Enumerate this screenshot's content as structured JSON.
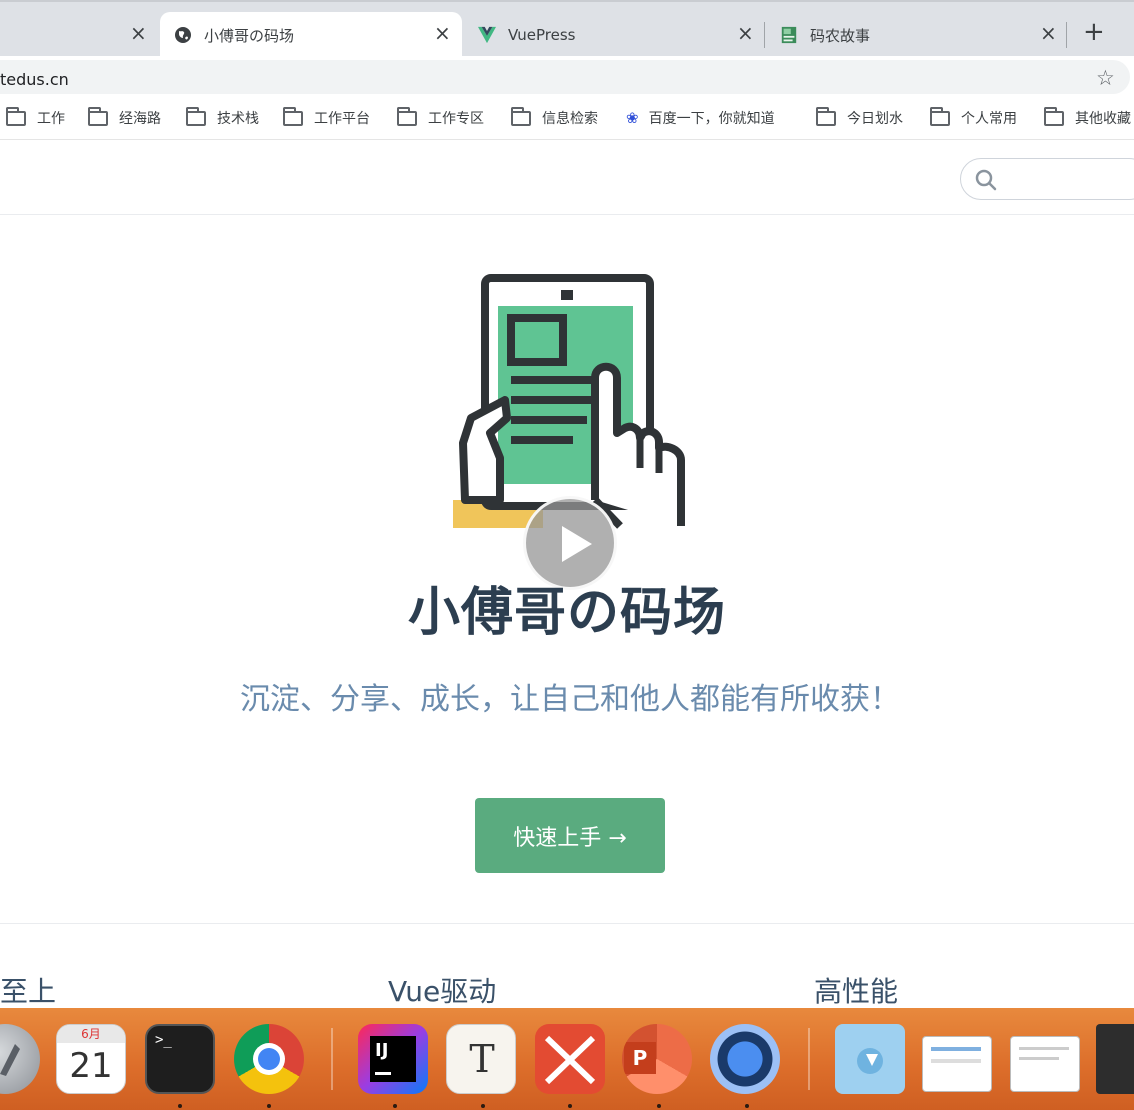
{
  "tabs": [
    {
      "label": "",
      "close": "×"
    },
    {
      "label": "小傅哥の码场",
      "close": "×"
    },
    {
      "label": "VuePress",
      "close": "×"
    },
    {
      "label": "码农故事",
      "close": "×"
    }
  ],
  "new_tab": "+",
  "address": {
    "url": "tedus.cn",
    "star": "☆"
  },
  "bookmarks": [
    {
      "label": "工作"
    },
    {
      "label": "经海路"
    },
    {
      "label": "技术栈"
    },
    {
      "label": "工作平台"
    },
    {
      "label": "工作专区"
    },
    {
      "label": "信息检索"
    },
    {
      "label": "百度一下，你就知道"
    },
    {
      "label": "今日划水"
    },
    {
      "label": "个人常用"
    },
    {
      "label": "其他收藏"
    }
  ],
  "hero": {
    "title": "小傅哥の码场",
    "description": "沉淀、分享、成长，让自己和他人都能有所收获！",
    "action": "快速上手 →"
  },
  "features": [
    "简洁至上",
    "Vue驱动",
    "高性能"
  ],
  "dock": {
    "calendar_month": "6月",
    "calendar_day": "21",
    "terminal_prompt": ">_",
    "intellij_label": "IJ",
    "typora_label": "T",
    "powerpoint_label": "P"
  },
  "colors": {
    "accent": "#5aab7f",
    "title": "#2c3e50",
    "description": "#6a8bad",
    "dock": "#dc6d2a"
  }
}
